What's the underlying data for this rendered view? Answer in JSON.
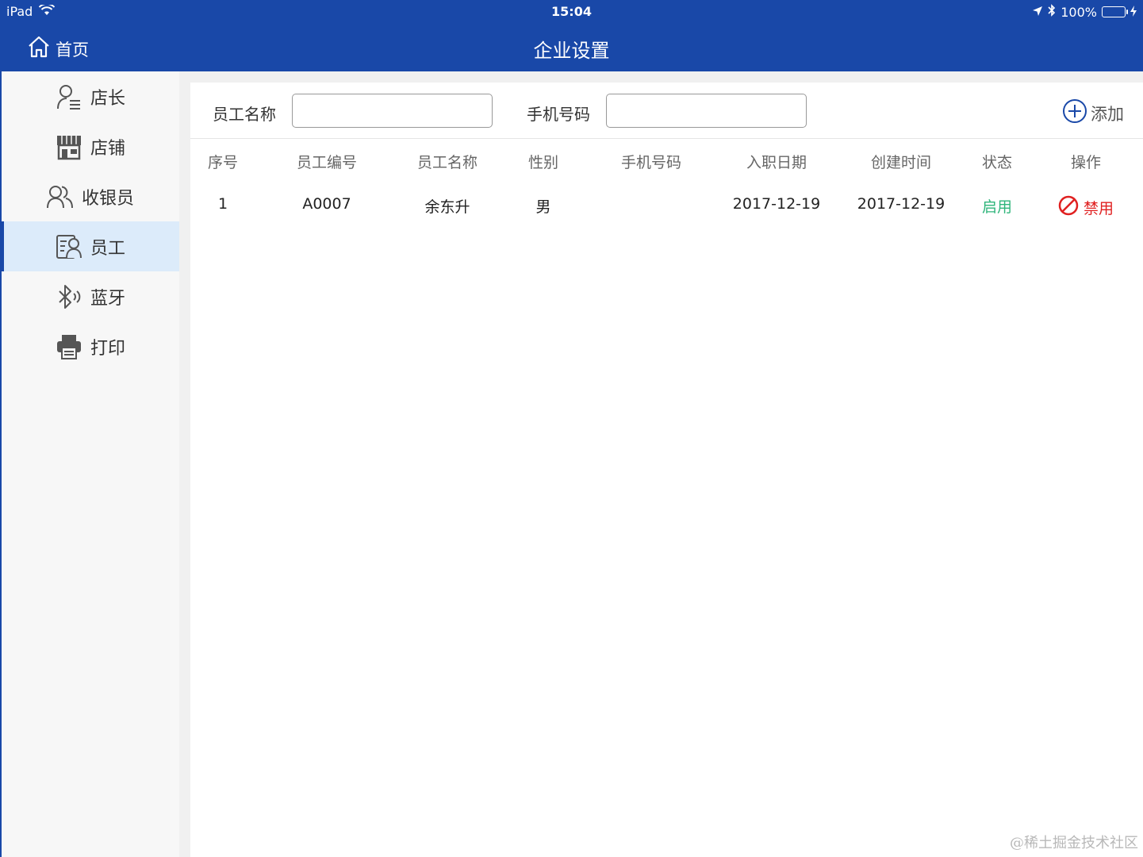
{
  "status_bar": {
    "device": "iPad",
    "time": "15:04",
    "battery": "100%"
  },
  "nav": {
    "home_label": "首页",
    "title": "企业设置"
  },
  "sidebar": {
    "items": [
      {
        "label": "店长",
        "icon": "user-list-icon"
      },
      {
        "label": "店铺",
        "icon": "store-icon"
      },
      {
        "label": "收银员",
        "icon": "users-icon"
      },
      {
        "label": "员工",
        "icon": "employee-card-icon",
        "active": true
      },
      {
        "label": "蓝牙",
        "icon": "bluetooth-icon"
      },
      {
        "label": "打印",
        "icon": "printer-icon"
      }
    ]
  },
  "filters": {
    "name_label": "员工名称",
    "name_value": "",
    "phone_label": "手机号码",
    "phone_value": "",
    "add_label": "添加"
  },
  "table": {
    "headers": [
      "序号",
      "员工编号",
      "员工名称",
      "性别",
      "手机号码",
      "入职日期",
      "创建时间",
      "状态",
      "操作"
    ],
    "rows": [
      {
        "index": "1",
        "code": "A0007",
        "name": "余东升",
        "gender": "男",
        "phone": "",
        "hire_date": "2017-12-19",
        "created": "2017-12-19",
        "status": "启用",
        "action": "禁用"
      }
    ]
  },
  "colors": {
    "header_bg": "#1948a8",
    "status_enabled": "#2fb57b",
    "action_disable": "#e02020",
    "active_item_bg": "#dcebfa"
  },
  "watermark": "@稀土掘金技术社区"
}
